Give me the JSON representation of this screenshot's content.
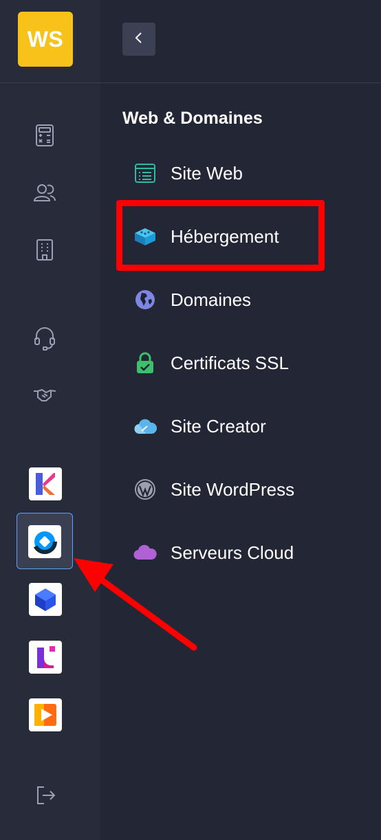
{
  "rail": {
    "logo_text": "WS",
    "nav_icons": [
      "calculator-icon",
      "users-icon",
      "building-icon",
      "headset-icon",
      "handshake-icon"
    ],
    "apps": [
      {
        "name": "kchat-app",
        "selected": false
      },
      {
        "name": "kdrive-app",
        "selected": true
      },
      {
        "name": "cube-app",
        "selected": false
      },
      {
        "name": "swisstransfer-app",
        "selected": false
      },
      {
        "name": "play-app",
        "selected": false
      }
    ],
    "logout_icon": "logout-icon"
  },
  "header": {
    "collapse_icon": "chevron-left-icon"
  },
  "menu": {
    "section_title": "Web & Domaines",
    "items": [
      {
        "label": "Site Web",
        "icon": "list-window-icon",
        "color": "#35b8a1"
      },
      {
        "label": "Hébergement",
        "icon": "server-box-icon",
        "color": "#1b9bd7"
      },
      {
        "label": "Domaines",
        "icon": "globe-icon",
        "color": "#7e86e3"
      },
      {
        "label": "Certificats SSL",
        "icon": "lock-icon",
        "color": "#3cc06c"
      },
      {
        "label": "Site Creator",
        "icon": "cloud-cursor-icon",
        "color": "#5bb5e8"
      },
      {
        "label": "Site WordPress",
        "icon": "wordpress-icon",
        "color": "#9aa0ad"
      },
      {
        "label": "Serveurs Cloud",
        "icon": "cloud-icon",
        "color": "#b062d5"
      }
    ]
  },
  "annotation": {
    "highlight_color": "#ff0000",
    "arrow_color": "#ff0000"
  }
}
